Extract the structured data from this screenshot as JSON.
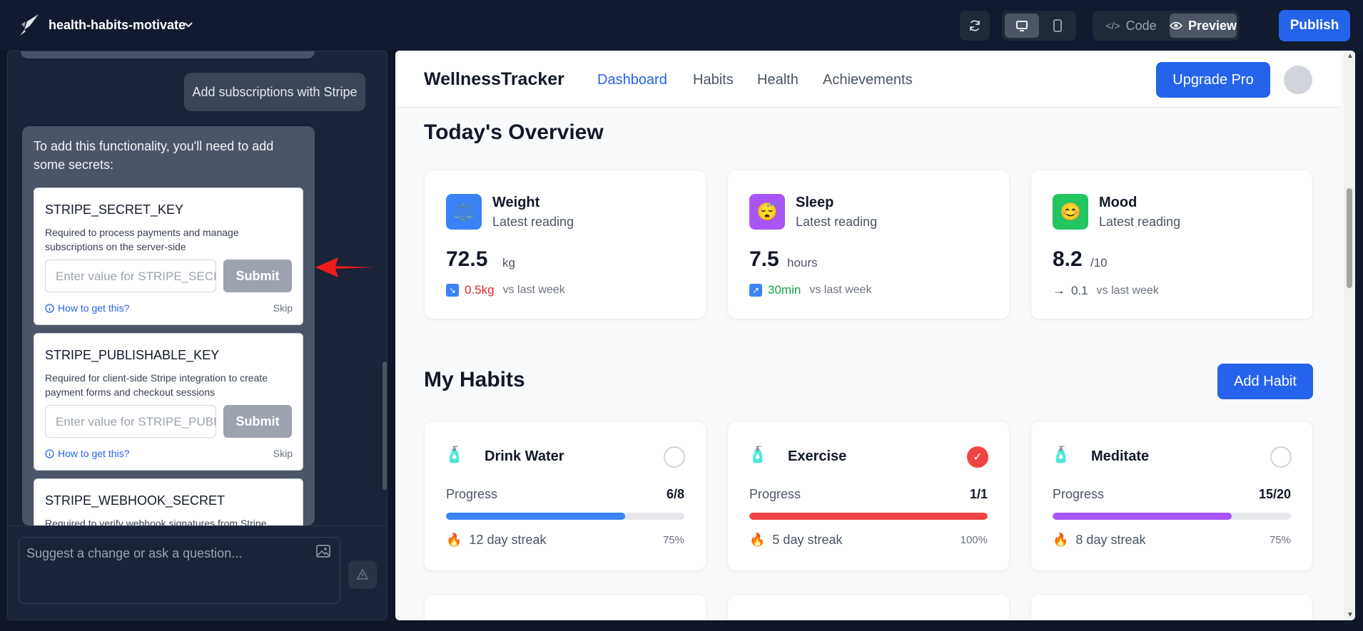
{
  "header": {
    "project_name": "health-habits-motivate",
    "code_label": "Code",
    "preview_label": "Preview",
    "publish_label": "Publish"
  },
  "chat": {
    "user_message": "Add subscriptions with Stripe",
    "assistant_intro": "To add this functionality, you'll need to add some secrets:",
    "secrets": [
      {
        "name": "STRIPE_SECRET_KEY",
        "description": "Required to process payments and manage subscriptions on the server-side",
        "placeholder": "Enter value for STRIPE_SECRET_KEY",
        "submit": "Submit",
        "help": "How to get this?",
        "skip": "Skip"
      },
      {
        "name": "STRIPE_PUBLISHABLE_KEY",
        "description": "Required for client-side Stripe integration to create payment forms and checkout sessions",
        "placeholder": "Enter value for STRIPE_PUBLISHABLE_KEY",
        "submit": "Submit",
        "help": "How to get this?",
        "skip": "Skip"
      },
      {
        "name": "STRIPE_WEBHOOK_SECRET",
        "description": "Required to verify webhook signatures from Stripe"
      }
    ],
    "input_placeholder": "Suggest a change or ask a question..."
  },
  "app": {
    "brand": "WellnessTracker",
    "nav": [
      "Dashboard",
      "Habits",
      "Health",
      "Achievements"
    ],
    "upgrade_label": "Upgrade Pro",
    "overview_title": "Today's Overview",
    "overview": [
      {
        "name": "Weight",
        "sub": "Latest reading",
        "value": "72.5",
        "unit": "kg",
        "change": "0.5kg",
        "vs": "vs last week",
        "icon": "⚖️",
        "icon_bg": "#3b82f6",
        "change_color": "#dc2626",
        "change_icon": "↘",
        "change_icon_bg": "#3b82f6"
      },
      {
        "name": "Sleep",
        "sub": "Latest reading",
        "value": "7.5",
        "unit": "hours",
        "change": "30min",
        "vs": "vs last week",
        "icon": "😴",
        "icon_bg": "#a855f7",
        "change_color": "#16a34a",
        "change_icon": "↗",
        "change_icon_bg": "#3b82f6"
      },
      {
        "name": "Mood",
        "sub": "Latest reading",
        "value": "8.2",
        "unit": "/10",
        "change": "0.1",
        "vs": "vs last week",
        "icon": "😊",
        "icon_bg": "#22c55e",
        "change_color": "#4b5563",
        "change_icon": "→",
        "change_icon_bg": "transparent"
      }
    ],
    "habits_title": "My Habits",
    "add_habit_label": "Add Habit",
    "habits": [
      {
        "name": "Drink Water",
        "icon": "🧴",
        "progress_label": "Progress",
        "count": "6/8",
        "progress": 0.75,
        "color": "#3b82f6",
        "streak": "12 day streak",
        "pct": "75%",
        "done": false
      },
      {
        "name": "Exercise",
        "icon": "🧴",
        "progress_label": "Progress",
        "count": "1/1",
        "progress": 1.0,
        "color": "#ef4444",
        "streak": "5 day streak",
        "pct": "100%",
        "done": true
      },
      {
        "name": "Meditate",
        "icon": "🧴",
        "progress_label": "Progress",
        "count": "15/20",
        "progress": 0.75,
        "color": "#a855f7",
        "streak": "8 day streak",
        "pct": "75%",
        "done": false
      }
    ]
  }
}
